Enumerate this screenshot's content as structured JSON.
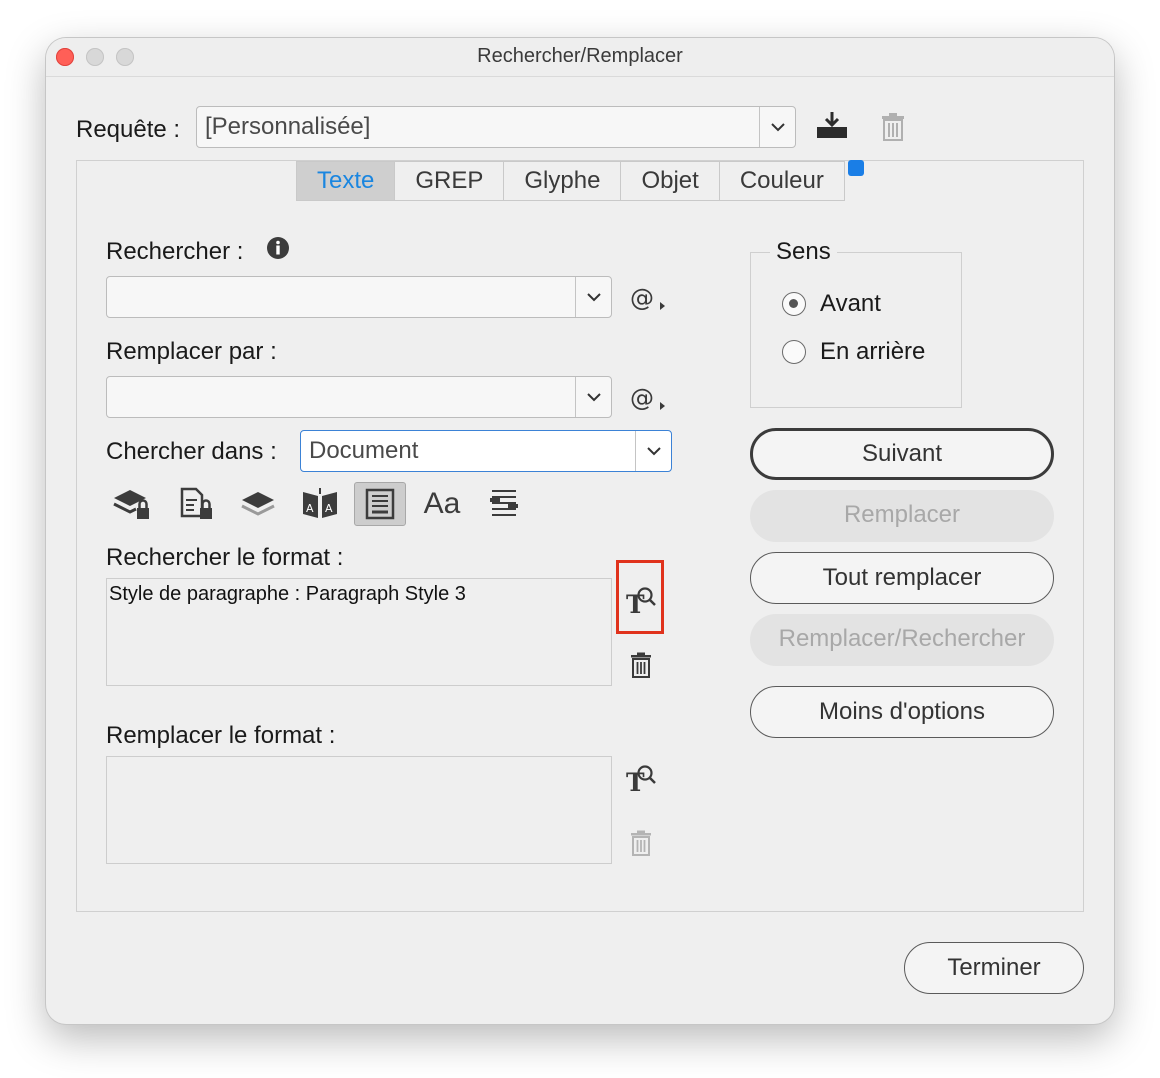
{
  "window": {
    "title": "Rechercher/Remplacer"
  },
  "query": {
    "label": "Requête :",
    "value": "[Personnalisée]"
  },
  "tabs": [
    "Texte",
    "GREP",
    "Glyphe",
    "Objet",
    "Couleur"
  ],
  "active_tab": "Texte",
  "find": {
    "label": "Rechercher :",
    "value": ""
  },
  "replace": {
    "label": "Remplacer par :",
    "value": ""
  },
  "search_in": {
    "label": "Chercher dans :",
    "value": "Document"
  },
  "options_icons": [
    "locked-layers-icon",
    "locked-stories-icon",
    "hidden-layers-icon",
    "master-pages-icon",
    "footnotes-icon",
    "case-sensitive-icon",
    "whole-word-icon"
  ],
  "options_case_label": "Aa",
  "find_format": {
    "label": "Rechercher le format :",
    "value": "Style de paragraphe : Paragraph Style 3"
  },
  "change_format": {
    "label": "Remplacer le format :",
    "value": ""
  },
  "direction": {
    "label": "Sens",
    "options": [
      "Avant",
      "En arrière"
    ],
    "selected": "Avant"
  },
  "buttons": {
    "next": "Suivant",
    "replace": "Remplacer",
    "replace_all": "Tout remplacer",
    "replace_find": "Remplacer/Rechercher",
    "fewer_options": "Moins d'options",
    "done": "Terminer"
  },
  "colors": {
    "accent": "#1a86e0",
    "highlight": "#e0321c",
    "badge": "#1a7ee6"
  }
}
